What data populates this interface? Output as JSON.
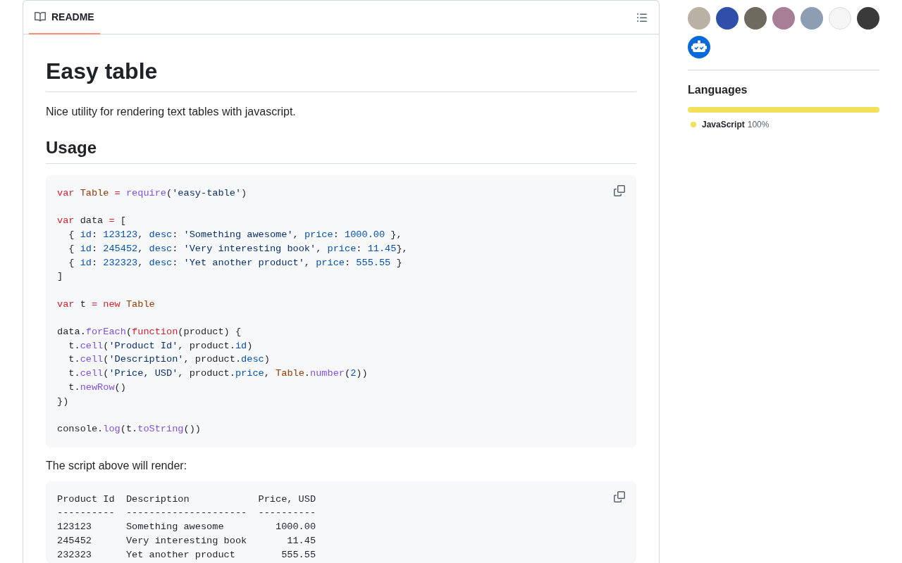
{
  "readme": {
    "tabs": [
      {
        "label": "README",
        "selected": true
      }
    ],
    "content": [
      {
        "kind": "heading1",
        "text": "Easy table"
      },
      {
        "kind": "paragraph",
        "text": "Nice utility for rendering text tables with javascript."
      },
      {
        "kind": "heading2",
        "text": "Usage"
      },
      {
        "kind": "code",
        "copy_button": true,
        "groups": [
          [
            [
              {
                "kind": "keyword",
                "text": "var "
              },
              {
                "kind": "entity",
                "text": "Table "
              },
              {
                "kind": "keyword",
                "text": "= "
              },
              {
                "kind": "function",
                "text": "require"
              },
              {
                "kind": "plain",
                "text": "("
              },
              {
                "kind": "string",
                "text": "'easy-table'"
              },
              {
                "kind": "plain",
                "text": ")"
              }
            ]
          ],
          [
            [
              {
                "kind": "keyword",
                "text": "var"
              },
              {
                "kind": "plain",
                "text": " data "
              },
              {
                "kind": "keyword",
                "text": "="
              },
              {
                "kind": "plain",
                "text": " ["
              }
            ],
            [
              {
                "kind": "plain",
                "text": "  { "
              },
              {
                "kind": "constant",
                "text": "id"
              },
              {
                "kind": "plain",
                "text": ": "
              },
              {
                "kind": "constant",
                "text": "123123"
              },
              {
                "kind": "plain",
                "text": ", "
              },
              {
                "kind": "constant",
                "text": "desc"
              },
              {
                "kind": "plain",
                "text": ": "
              },
              {
                "kind": "string",
                "text": "'Something awesome'"
              },
              {
                "kind": "plain",
                "text": ", "
              },
              {
                "kind": "constant",
                "text": "price"
              },
              {
                "kind": "plain",
                "text": ": "
              },
              {
                "kind": "constant",
                "text": "1000.00"
              },
              {
                "kind": "plain",
                "text": " },"
              }
            ],
            [
              {
                "kind": "plain",
                "text": "  { "
              },
              {
                "kind": "constant",
                "text": "id"
              },
              {
                "kind": "plain",
                "text": ": "
              },
              {
                "kind": "constant",
                "text": "245452"
              },
              {
                "kind": "plain",
                "text": ", "
              },
              {
                "kind": "constant",
                "text": "desc"
              },
              {
                "kind": "plain",
                "text": ": "
              },
              {
                "kind": "string",
                "text": "'Very interesting book'"
              },
              {
                "kind": "plain",
                "text": ", "
              },
              {
                "kind": "constant",
                "text": "price"
              },
              {
                "kind": "plain",
                "text": ": "
              },
              {
                "kind": "constant",
                "text": "11.45"
              },
              {
                "kind": "plain",
                "text": "},"
              }
            ],
            [
              {
                "kind": "plain",
                "text": "  { "
              },
              {
                "kind": "constant",
                "text": "id"
              },
              {
                "kind": "plain",
                "text": ": "
              },
              {
                "kind": "constant",
                "text": "232323"
              },
              {
                "kind": "plain",
                "text": ", "
              },
              {
                "kind": "constant",
                "text": "desc"
              },
              {
                "kind": "plain",
                "text": ": "
              },
              {
                "kind": "string",
                "text": "'Yet another product'"
              },
              {
                "kind": "plain",
                "text": ", "
              },
              {
                "kind": "constant",
                "text": "price"
              },
              {
                "kind": "plain",
                "text": ": "
              },
              {
                "kind": "constant",
                "text": "555.55"
              },
              {
                "kind": "plain",
                "text": " }"
              }
            ],
            [
              {
                "kind": "plain",
                "text": "]"
              }
            ]
          ],
          [
            [
              {
                "kind": "keyword",
                "text": "var"
              },
              {
                "kind": "plain",
                "text": " t "
              },
              {
                "kind": "keyword",
                "text": "= "
              },
              {
                "kind": "keyword",
                "text": "new "
              },
              {
                "kind": "entity",
                "text": "Table"
              }
            ]
          ],
          [
            [
              {
                "kind": "plain",
                "text": "data."
              },
              {
                "kind": "function",
                "text": "forEach"
              },
              {
                "kind": "plain",
                "text": "("
              },
              {
                "kind": "keyword",
                "text": "function"
              },
              {
                "kind": "plain",
                "text": "(product) {"
              }
            ],
            [
              {
                "kind": "plain",
                "text": "  t."
              },
              {
                "kind": "function",
                "text": "cell"
              },
              {
                "kind": "plain",
                "text": "("
              },
              {
                "kind": "string",
                "text": "'Product Id'"
              },
              {
                "kind": "plain",
                "text": ", product."
              },
              {
                "kind": "constant",
                "text": "id"
              },
              {
                "kind": "plain",
                "text": ")"
              }
            ],
            [
              {
                "kind": "plain",
                "text": "  t."
              },
              {
                "kind": "function",
                "text": "cell"
              },
              {
                "kind": "plain",
                "text": "("
              },
              {
                "kind": "string",
                "text": "'Description'"
              },
              {
                "kind": "plain",
                "text": ", product."
              },
              {
                "kind": "constant",
                "text": "desc"
              },
              {
                "kind": "plain",
                "text": ")"
              }
            ],
            [
              {
                "kind": "plain",
                "text": "  t."
              },
              {
                "kind": "function",
                "text": "cell"
              },
              {
                "kind": "plain",
                "text": "("
              },
              {
                "kind": "string",
                "text": "'Price, USD'"
              },
              {
                "kind": "plain",
                "text": ", product."
              },
              {
                "kind": "constant",
                "text": "price"
              },
              {
                "kind": "plain",
                "text": ", "
              },
              {
                "kind": "entity",
                "text": "Table"
              },
              {
                "kind": "plain",
                "text": "."
              },
              {
                "kind": "function",
                "text": "number"
              },
              {
                "kind": "plain",
                "text": "("
              },
              {
                "kind": "constant",
                "text": "2"
              },
              {
                "kind": "plain",
                "text": "))"
              }
            ],
            [
              {
                "kind": "plain",
                "text": "  t."
              },
              {
                "kind": "function",
                "text": "newRow"
              },
              {
                "kind": "plain",
                "text": "()"
              }
            ],
            [
              {
                "kind": "plain",
                "text": "})"
              }
            ]
          ],
          [
            [
              {
                "kind": "plain",
                "text": "console."
              },
              {
                "kind": "function",
                "text": "log"
              },
              {
                "kind": "plain",
                "text": "(t."
              },
              {
                "kind": "function",
                "text": "toString"
              },
              {
                "kind": "plain",
                "text": "())"
              }
            ]
          ]
        ]
      },
      {
        "kind": "paragraph",
        "text": "The script above will render:"
      },
      {
        "kind": "code",
        "copy_button": true,
        "groups": [
          [
            [
              {
                "kind": "plain",
                "text": "Product Id  Description            Price, USD"
              }
            ],
            [
              {
                "kind": "plain",
                "text": "----------  ---------------------  ----------"
              }
            ],
            [
              {
                "kind": "plain",
                "text": "123123      Something awesome         1000.00"
              }
            ],
            [
              {
                "kind": "plain",
                "text": "245452      Very interesting book       11.45"
              }
            ],
            [
              {
                "kind": "plain",
                "text": "232323      Yet another product        555.55"
              }
            ]
          ]
        ]
      }
    ]
  },
  "sidebar": {
    "contributors": [
      {
        "kind": "photo"
      },
      {
        "kind": "photo"
      },
      {
        "kind": "photo"
      },
      {
        "kind": "photo"
      },
      {
        "kind": "photo"
      },
      {
        "kind": "photo"
      },
      {
        "kind": "photo"
      },
      {
        "kind": "bot"
      }
    ],
    "languages_heading": "Languages",
    "languages": [
      {
        "name": "JavaScript",
        "percent": "100%",
        "level": 1,
        "color": "#f1e05a"
      }
    ]
  }
}
